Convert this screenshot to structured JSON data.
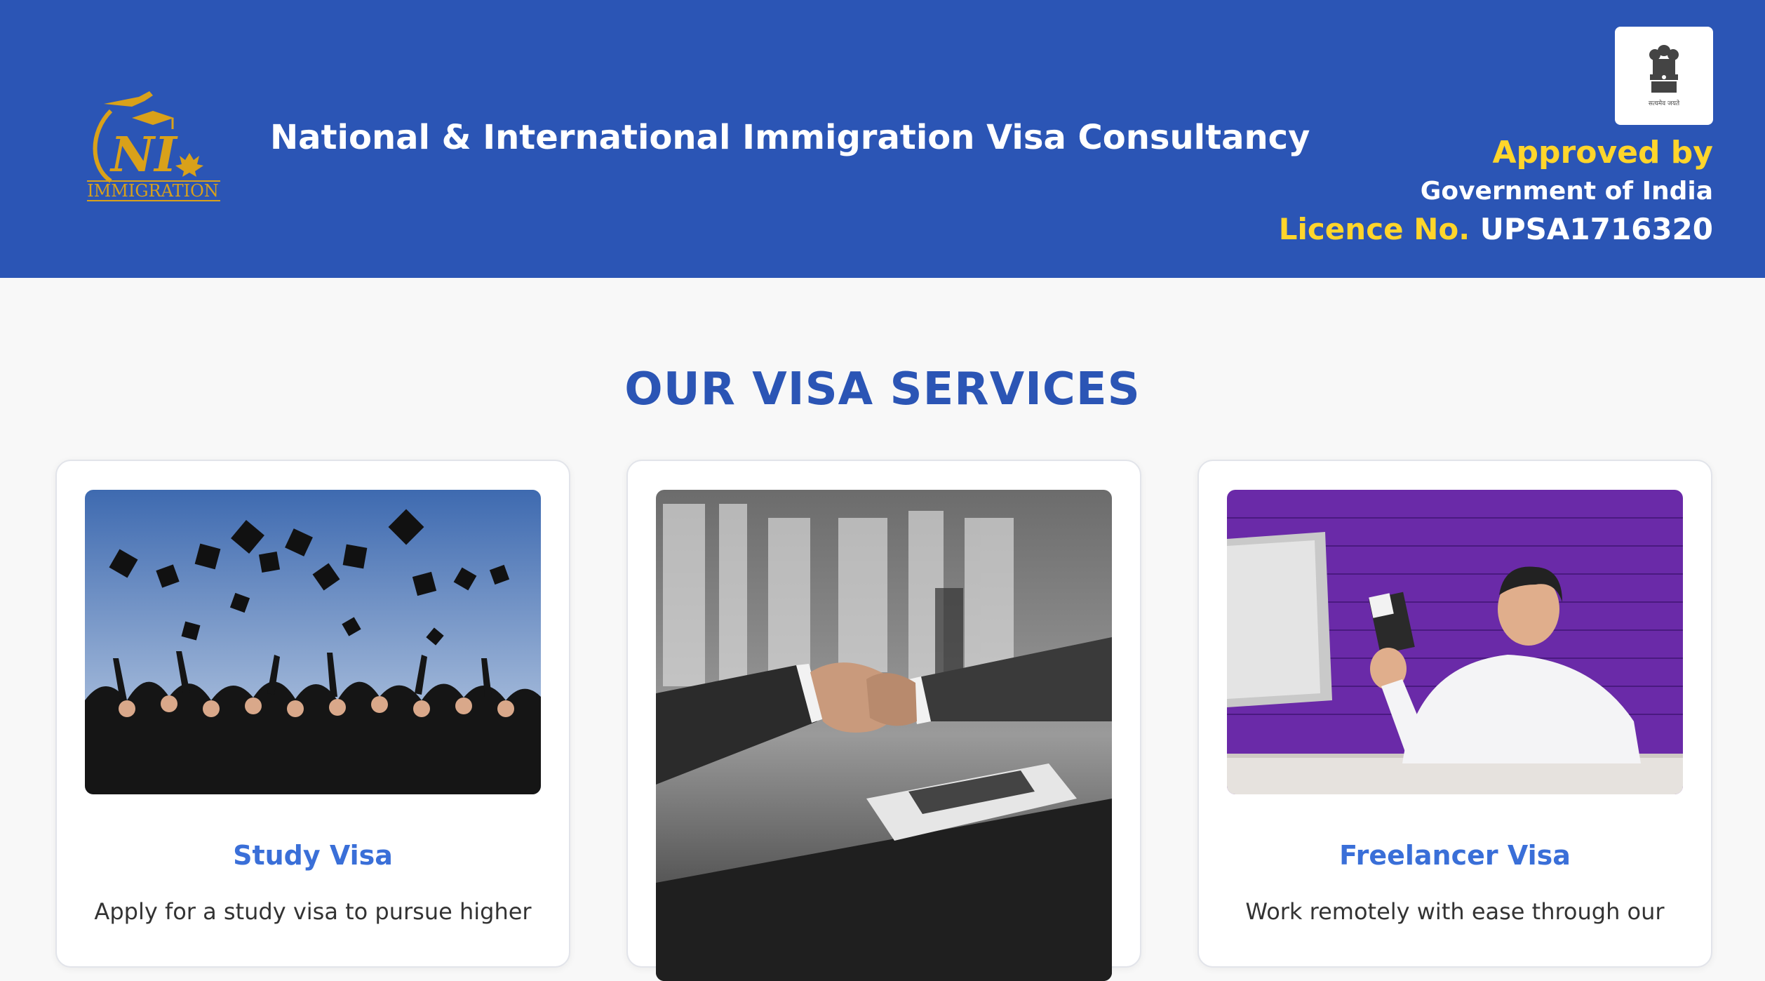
{
  "header": {
    "logo": {
      "initials": "NI",
      "word": "IMMIGRATION",
      "gold": "#d9a11a"
    },
    "title": "National & International Immigration Visa Consultancy",
    "emblem_icon": "national-emblem-icon",
    "emblem_caption": "सत्यमेव जयते",
    "approved_by": "Approved by",
    "government": "Government of India",
    "licence_label": "Licence No.",
    "licence_number": "UPSA1716320"
  },
  "colors": {
    "brand_blue": "#2b55b5",
    "accent_yellow": "#ffd52b",
    "card_title_blue": "#3a6fd8"
  },
  "services": {
    "heading": "OUR VISA SERVICES",
    "cards": [
      {
        "title": "Study Visa",
        "description": "Apply for a study visa to pursue higher",
        "image_icon": "graduation-caps-photo"
      },
      {
        "title": "",
        "description": "",
        "image_icon": "business-handshake-photo"
      },
      {
        "title": "Freelancer Visa",
        "description": "Work remotely with ease through our",
        "image_icon": "man-with-passport-photo"
      }
    ]
  }
}
